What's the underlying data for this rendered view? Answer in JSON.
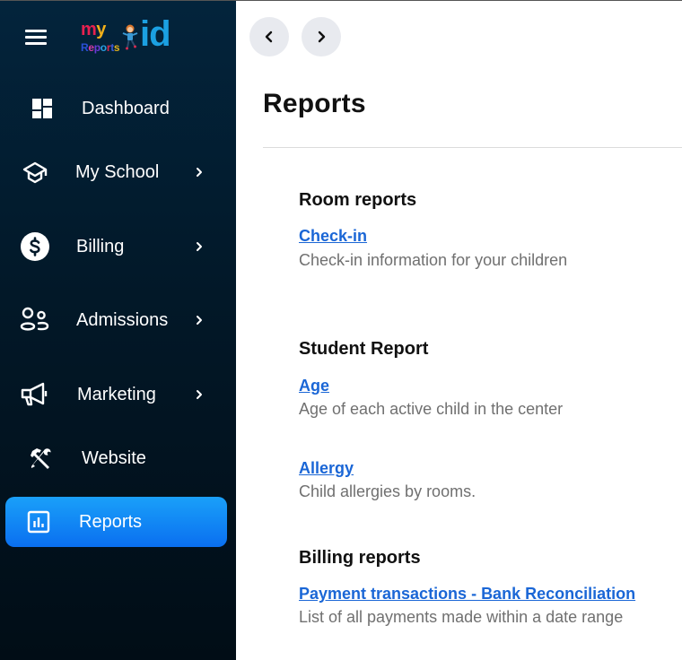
{
  "app": {
    "logo": {
      "my_m": "m",
      "my_y": "y",
      "reports_letters": [
        {
          "ch": "R",
          "color": "#2a4fd6"
        },
        {
          "ch": "e",
          "color": "#d63aa8"
        },
        {
          "ch": "p",
          "color": "#6a3ad6"
        },
        {
          "ch": "o",
          "color": "#2aa0e2"
        },
        {
          "ch": "r",
          "color": "#d62a4f"
        },
        {
          "ch": "t",
          "color": "#3a5ad6"
        },
        {
          "ch": "s",
          "color": "#e2b01a"
        }
      ],
      "id_text": "id"
    },
    "colors": {
      "sidebar_top": "#03243c",
      "sidebar_bottom": "#010d16",
      "active_item": "#0a84f6",
      "link": "#1a66d6",
      "muted_text": "#707070"
    }
  },
  "sidebar": {
    "items": [
      {
        "label": "Dashboard",
        "icon": "dashboard-icon",
        "has_submenu": false,
        "active": false
      },
      {
        "label": "My School",
        "icon": "graduation-cap-icon",
        "has_submenu": true,
        "active": false
      },
      {
        "label": "Billing",
        "icon": "dollar-circle-icon",
        "has_submenu": true,
        "active": false
      },
      {
        "label": "Admissions",
        "icon": "users-icon",
        "has_submenu": true,
        "active": false
      },
      {
        "label": "Marketing",
        "icon": "megaphone-icon",
        "has_submenu": true,
        "active": false
      },
      {
        "label": "Website",
        "icon": "tools-icon",
        "has_submenu": false,
        "active": false
      },
      {
        "label": "Reports",
        "icon": "bar-chart-icon",
        "has_submenu": false,
        "active": true
      }
    ]
  },
  "main": {
    "back_button": "chevron-left-icon",
    "forward_button": "chevron-right-icon",
    "title": "Reports",
    "sections": [
      {
        "title": "Room reports",
        "reports": [
          {
            "name": "Check-in",
            "description": "Check-in information for your children"
          }
        ]
      },
      {
        "title": "Student Report",
        "reports": [
          {
            "name": "Age",
            "description": "Age of each active child in the center"
          },
          {
            "name": "Allergy",
            "description": "Child allergies by rooms."
          }
        ]
      },
      {
        "title": "Billing reports",
        "reports": [
          {
            "name": "Payment transactions - Bank Reconciliation",
            "description": "List of all payments made within a date range"
          }
        ]
      }
    ]
  }
}
